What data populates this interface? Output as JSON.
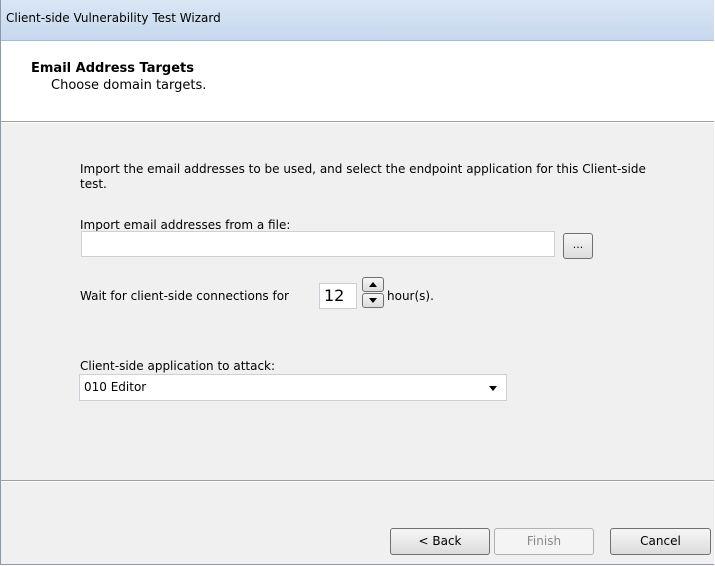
{
  "window": {
    "title": "Client-side Vulnerability Test Wizard"
  },
  "header": {
    "title": "Email Address Targets",
    "subtitle": "Choose domain targets."
  },
  "content": {
    "intro": "Import the email addresses to be used, and select the endpoint application for this Client-side test.",
    "import_label": "Import email addresses from a file:",
    "import_value": "",
    "browse_label": "...",
    "wait_label": "Wait for client-side connections for",
    "hours_value": "12",
    "hours_unit": "hour(s).",
    "attack_label": "Client-side application to attack:",
    "attack_selected": "010 Editor"
  },
  "footer": {
    "back_label": "< Back",
    "finish_label": "Finish",
    "cancel_label": "Cancel"
  }
}
